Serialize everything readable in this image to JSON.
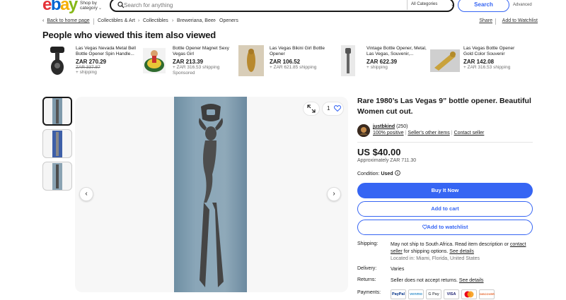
{
  "header": {
    "logo": [
      "e",
      "b",
      "a",
      "y"
    ],
    "shop_by_label": "Shop by category",
    "search_placeholder": "Search for anything",
    "category_select": "All Categories",
    "search_button": "Search",
    "advanced_link": "Advanced"
  },
  "breadcrumb": {
    "back_label": "Back to home page",
    "items": [
      "Collectibles & Art",
      "Collectibles",
      "Breweriana, Beer",
      "Openers"
    ],
    "share": "Share",
    "add_watchlist": "Add to Watchlist"
  },
  "related": {
    "title": "People who viewed this item also viewed",
    "items": [
      {
        "title": "Las Vegas Nevada Metal Bell Bottle Opener Spin Handle...",
        "price": "ZAR 270.29",
        "strike": "ZAR 337.87",
        "shipping": "+ shipping",
        "sponsored": ""
      },
      {
        "title": "Bottle Opener Magnet Sexy Vegas Girl",
        "price": "ZAR 213.39",
        "strike": "",
        "shipping": "+ ZAR 316.53 shipping",
        "sponsored": "Sponsored"
      },
      {
        "title": "Las Vegas Bikini Girl Bottle Opener",
        "price": "ZAR 106.52",
        "strike": "",
        "shipping": "+ ZAR 621.85 shipping",
        "sponsored": ""
      },
      {
        "title": "Vintage Bottle Opener, Metal, Las Vegas, Souvenir,...",
        "price": "ZAR 622.39",
        "strike": "",
        "shipping": "+ shipping",
        "sponsored": ""
      },
      {
        "title": "Las Vegas Bottle Opener Gold Color Souvenir",
        "price": "ZAR 142.08",
        "strike": "",
        "shipping": "+ ZAR 316.53 shipping",
        "sponsored": ""
      }
    ]
  },
  "gallery": {
    "like_count": "1"
  },
  "item": {
    "title": "Rare 1980’s Las Vegas 9” bottle opener. Beautiful Women cut out.",
    "seller_name": "justbkind",
    "seller_score": "(250)",
    "seller_positive": "100% positive",
    "seller_other": "Seller's other items",
    "contact_seller": "Contact seller",
    "price": "US $40.00",
    "approx": "Approximately ZAR 711.30",
    "condition_label": "Condition:",
    "condition_value": "Used",
    "buy_now": "Buy It Now",
    "add_to_cart": "Add to cart",
    "add_to_watchlist": "Add to watchlist"
  },
  "details": {
    "shipping_label": "Shipping:",
    "shipping_text_1": "May not ship to South Africa. Read item description or ",
    "shipping_link_1": "contact seller",
    "shipping_text_2": " for shipping options. ",
    "shipping_link_2": "See details",
    "located": "Located in: Miami, Florida, United States",
    "delivery_label": "Delivery:",
    "delivery_value": "Varies",
    "returns_label": "Returns:",
    "returns_text": "Seller does not accept returns. ",
    "returns_link": "See details",
    "payments_label": "Payments:",
    "payments": [
      "PayPal",
      "venmo",
      "G Pay",
      "VISA",
      "",
      "DISCOVER"
    ]
  },
  "colors": {
    "accent": "#3665f3",
    "text": "#191919",
    "muted": "#707070"
  }
}
